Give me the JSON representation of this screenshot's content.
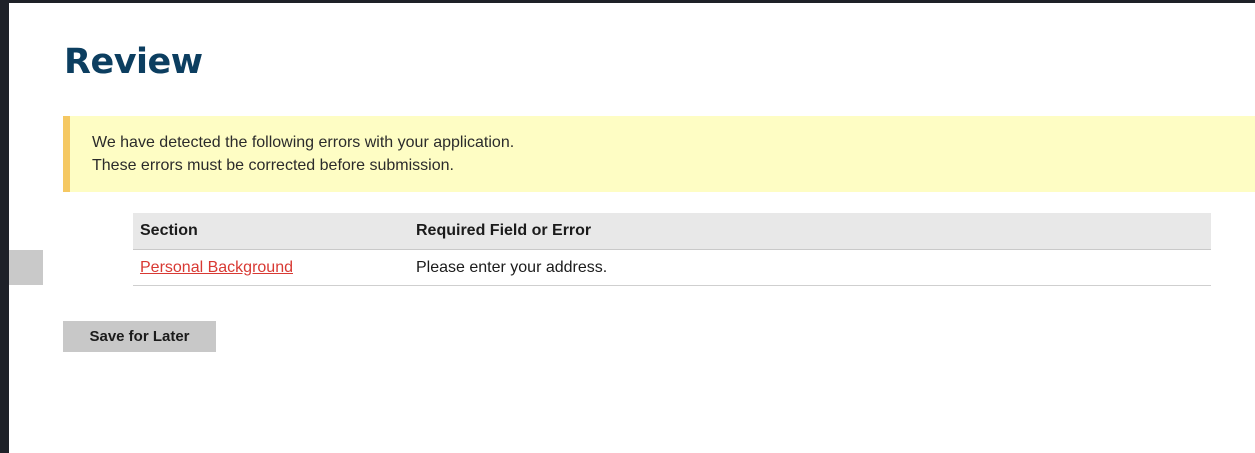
{
  "page": {
    "title": "Review"
  },
  "alert": {
    "line1": "We have detected the following errors with your application.",
    "line2": "These errors must be corrected before submission."
  },
  "errors_table": {
    "headers": [
      "Section",
      "Required Field or Error"
    ],
    "rows": [
      {
        "section": "Personal Background",
        "error": "Please enter your address."
      }
    ]
  },
  "actions": {
    "save_label": "Save for Later"
  },
  "colors": {
    "title": "#0c3e60",
    "alert_background": "#fefdc4",
    "alert_border": "#f5c862",
    "link": "#d83933",
    "button_background": "#c8c8c8",
    "table_header_background": "#e8e8e8"
  }
}
